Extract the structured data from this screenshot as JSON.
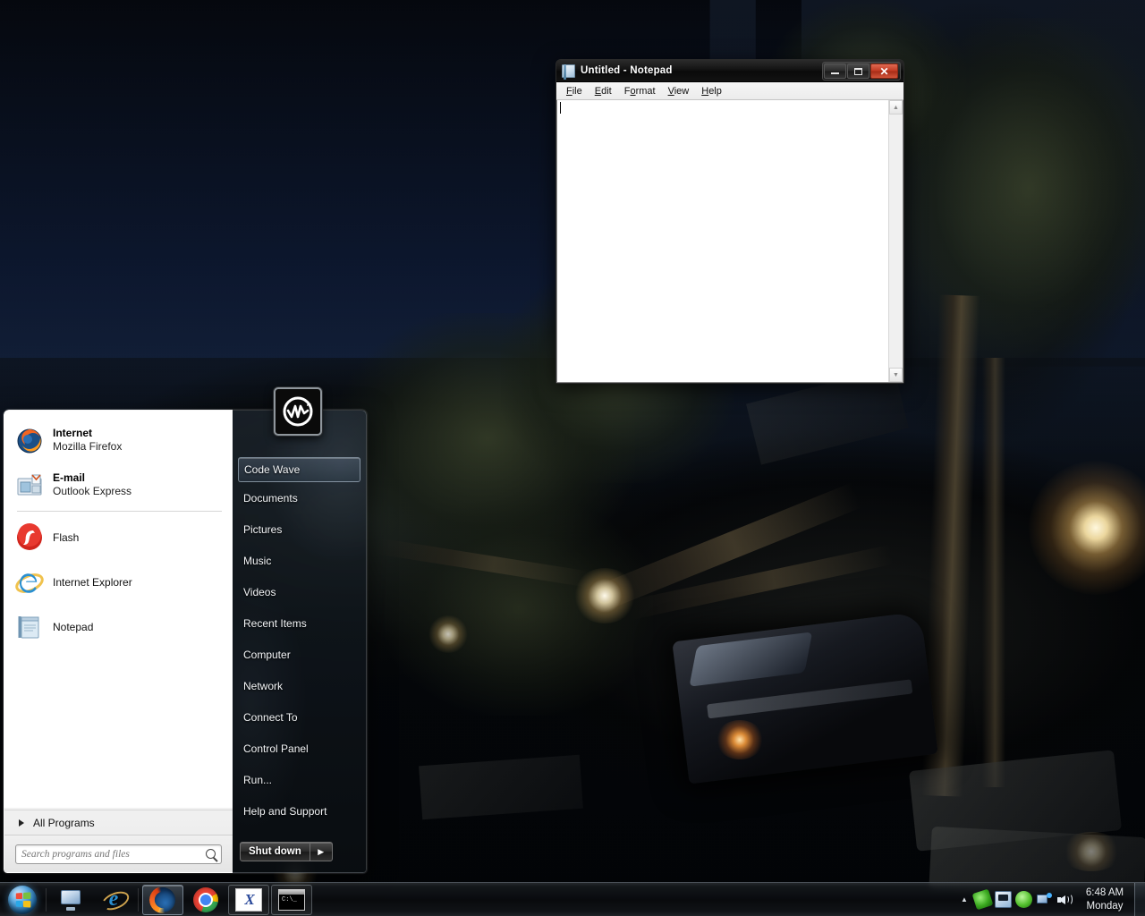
{
  "desktop": {
    "wallpaper_description": "dark post-apocalyptic city ruins at night with broken trees, wrecked SUV and bright light flares"
  },
  "notepad": {
    "title": "Untitled - Notepad",
    "icon": "notepad-icon",
    "window_controls": {
      "minimize": "–",
      "maximize": "□",
      "close": "✕"
    },
    "menus": [
      {
        "label": "File",
        "accel": "F"
      },
      {
        "label": "Edit",
        "accel": "E"
      },
      {
        "label": "Format",
        "accel": "o"
      },
      {
        "label": "View",
        "accel": "V"
      },
      {
        "label": "Help",
        "accel": "H"
      }
    ],
    "document_text": "",
    "scroll_up": "▲",
    "scroll_down": "▼"
  },
  "start_menu": {
    "user": {
      "name": "Code Wave",
      "avatar_icon": "code-wave-logo"
    },
    "pinned": [
      {
        "title": "Internet",
        "subtitle": "Mozilla Firefox",
        "icon": "firefox-icon"
      },
      {
        "title": "E-mail",
        "subtitle": "Outlook Express",
        "icon": "outlook-express-icon"
      }
    ],
    "programs": [
      {
        "title": "Flash",
        "icon": "flash-icon"
      },
      {
        "title": "Internet Explorer",
        "icon": "internet-explorer-icon"
      },
      {
        "title": "Notepad",
        "icon": "notepad-icon"
      }
    ],
    "all_programs": {
      "label": "All Programs",
      "icon": "chevron-right-icon"
    },
    "search": {
      "placeholder": "Search programs and files",
      "value": "",
      "icon": "search-icon"
    },
    "right_items": [
      {
        "label": "Code Wave",
        "active": true
      },
      {
        "label": "Documents",
        "active": false
      },
      {
        "label": "Pictures",
        "active": false
      },
      {
        "label": "Music",
        "active": false
      },
      {
        "label": "Videos",
        "active": false
      },
      {
        "label": "Recent Items",
        "active": false
      },
      {
        "label": "Computer",
        "active": false
      },
      {
        "label": "Network",
        "active": false
      },
      {
        "label": "Connect To",
        "active": false
      },
      {
        "label": "Control Panel",
        "active": false
      },
      {
        "label": "Run...",
        "active": false
      },
      {
        "label": "Help and Support",
        "active": false
      }
    ],
    "shutdown": {
      "label": "Shut down",
      "more_icon": "▶"
    }
  },
  "taskbar": {
    "start_button": {
      "name": "Start",
      "icon": "windows-orb-icon"
    },
    "quick_launch": [
      {
        "name": "Show Desktop",
        "icon": "show-desktop-icon",
        "active": false
      },
      {
        "name": "Internet Explorer",
        "icon": "internet-explorer-icon",
        "active": false
      }
    ],
    "windows": [
      {
        "name": "Mozilla Firefox",
        "icon": "firefox-icon",
        "active": true
      },
      {
        "name": "Google Chrome",
        "icon": "chrome-icon",
        "active": false
      },
      {
        "name": "X Application",
        "icon": "x-app-icon",
        "active": false
      },
      {
        "name": "Command Prompt",
        "icon": "command-prompt-icon",
        "active": false
      }
    ],
    "tray": {
      "show_hidden_icons": "▲",
      "icons": [
        {
          "name": "green-status-icon"
        },
        {
          "name": "screen-capture-icon"
        },
        {
          "name": "green-globe-icon"
        },
        {
          "name": "network-icon"
        },
        {
          "name": "volume-icon"
        }
      ],
      "clock": {
        "time": "6:48 AM",
        "day": "Monday"
      },
      "show_desktop": "Show desktop"
    }
  }
}
